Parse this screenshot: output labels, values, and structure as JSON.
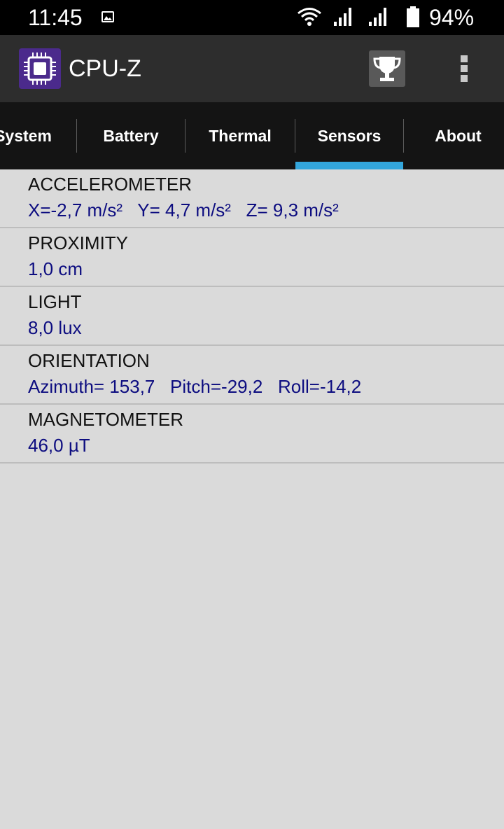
{
  "status_bar": {
    "time": "11:45",
    "battery_percent": "94%",
    "icons": [
      "gallery-icon",
      "wifi-icon",
      "signal-icon",
      "signal-icon",
      "battery-icon"
    ]
  },
  "app_bar": {
    "title": "CPU-Z",
    "logo_color": "#4b2a8c",
    "icons": [
      "cpu-logo-icon",
      "trophy-icon",
      "overflow-menu-icon"
    ]
  },
  "tabs": {
    "items": [
      {
        "label": "System"
      },
      {
        "label": "Battery"
      },
      {
        "label": "Thermal"
      },
      {
        "label": "Sensors"
      },
      {
        "label": "About"
      }
    ],
    "selected": "Sensors",
    "indicator_color": "#33a6dc"
  },
  "sensors": [
    {
      "label": "ACCELEROMETER",
      "value": "X=-2,7 m/s²   Y= 4,7 m/s²   Z= 9,3 m/s²"
    },
    {
      "label": "PROXIMITY",
      "value": "1,0 cm"
    },
    {
      "label": "LIGHT",
      "value": "8,0 lux"
    },
    {
      "label": "ORIENTATION",
      "value": "Azimuth= 153,7   Pitch=-29,2   Roll=-14,2"
    },
    {
      "label": "MAGNETOMETER",
      "value": "46,0 µT"
    }
  ]
}
